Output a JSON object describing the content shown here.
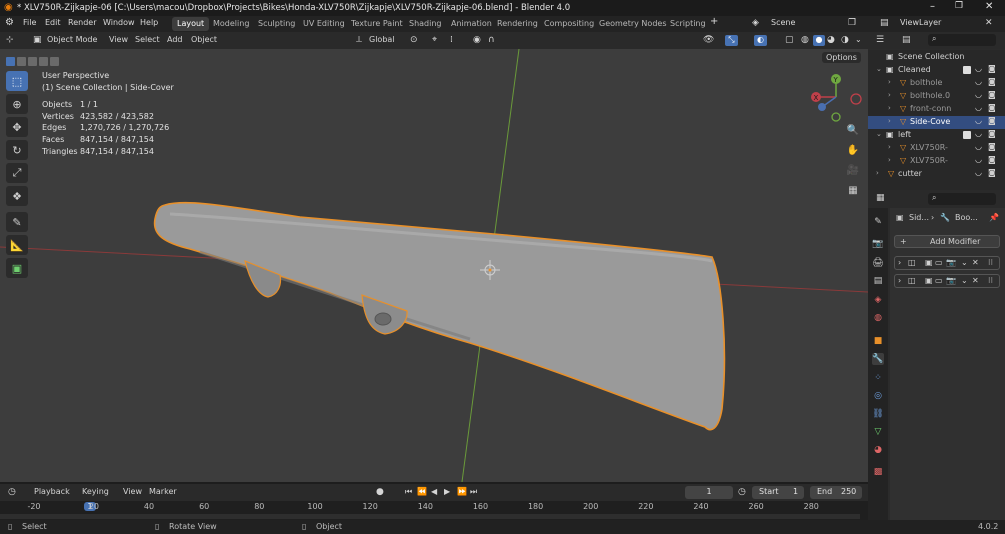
{
  "window": {
    "title": "* XLV750R-Zijkapje-06 [C:\\Users\\macou\\Dropbox\\Projects\\Bikes\\Honda-XLV750R\\Zijkapje\\XLV750R-Zijkapje-06.blend] - Blender 4.0"
  },
  "menu": {
    "items": [
      "File",
      "Edit",
      "Render",
      "Window",
      "Help"
    ]
  },
  "workspaces": [
    "Layout",
    "Modeling",
    "Sculpting",
    "UV Editing",
    "Texture Paint",
    "Shading",
    "Animation",
    "Rendering",
    "Compositing",
    "Geometry Nodes",
    "Scripting"
  ],
  "scene": {
    "label": "Scene"
  },
  "view_layer": {
    "label": "ViewLayer"
  },
  "viewport_header": {
    "mode": "Object Mode",
    "view": "View",
    "select": "Select",
    "add": "Add",
    "object": "Object",
    "transform": "Global"
  },
  "viewport": {
    "perspective": "User Perspective",
    "context": "(1) Scene Collection | Side-Cover",
    "options": "Options",
    "stats": [
      {
        "k": "Objects",
        "v": "1 / 1"
      },
      {
        "k": "Vertices",
        "v": "423,582 / 423,582"
      },
      {
        "k": "Edges",
        "v": "1,270,726 / 1,270,726"
      },
      {
        "k": "Faces",
        "v": "847,154 / 847,154"
      },
      {
        "k": "Triangles",
        "v": "847,154 / 847,154"
      }
    ]
  },
  "outliner": {
    "root": "Scene Collection",
    "items": [
      {
        "name": "Cleaned",
        "indent": 1
      },
      {
        "name": "bolthole",
        "indent": 2
      },
      {
        "name": "bolthole.0",
        "indent": 2
      },
      {
        "name": "front-conn",
        "indent": 2
      },
      {
        "name": "Side-Cove",
        "indent": 2,
        "selected": true
      },
      {
        "name": "left",
        "indent": 1
      },
      {
        "name": "XLV750R-",
        "indent": 2
      },
      {
        "name": "XLV750R-",
        "indent": 2
      },
      {
        "name": "cutter",
        "indent": 1
      }
    ]
  },
  "properties": {
    "breadcrumb_obj": "Sid...",
    "breadcrumb_mod": "Boo...",
    "add_modifier": "Add Modifier"
  },
  "timeline": {
    "playback": "Playback",
    "keying": "Keying",
    "view": "View",
    "marker": "Marker",
    "current_frame": "1",
    "start_label": "Start",
    "start": "1",
    "end_label": "End",
    "end": "250",
    "ticks": [
      "-20",
      "1",
      "20",
      "40",
      "60",
      "80",
      "100",
      "120",
      "140",
      "160",
      "180",
      "200",
      "220",
      "240",
      "260",
      "280"
    ]
  },
  "statusbar": {
    "select": "Select",
    "rotate": "Rotate View",
    "object": "Object",
    "version": "4.0.2"
  }
}
